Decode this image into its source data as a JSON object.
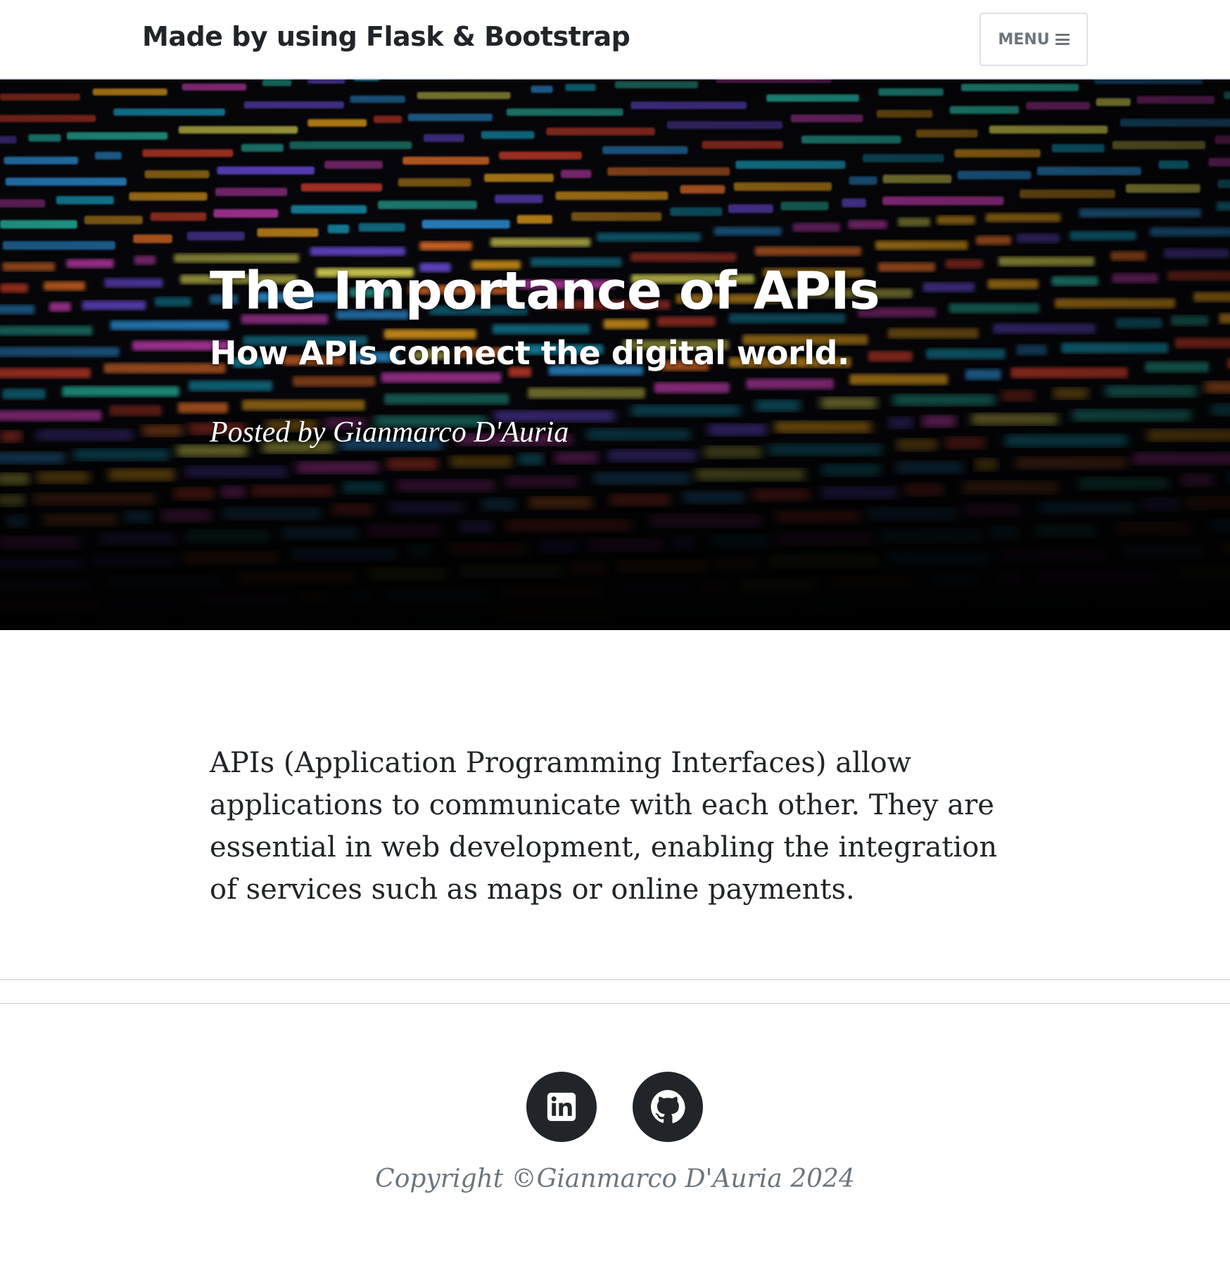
{
  "navbar": {
    "brand": "Made by using Flask & Bootstrap",
    "menu_label": "MENU"
  },
  "header": {
    "title": "The Importance of APIs",
    "subtitle": "How APIs connect the digital world.",
    "meta": "Posted by Gianmarco D'Auria"
  },
  "article": {
    "body": "APIs (Application Programming Interfaces) allow applications to communicate with each other. They are essential in web development, enabling the integration of services such as maps or online payments."
  },
  "footer": {
    "social": [
      {
        "name": "linkedin-icon"
      },
      {
        "name": "github-icon"
      }
    ],
    "copyright": "Copyright ©Gianmarco D'Auria 2024"
  },
  "colors": {
    "text": "#212529",
    "muted": "#6c757d",
    "border": "#dee2e6",
    "social_bg": "#212529"
  }
}
